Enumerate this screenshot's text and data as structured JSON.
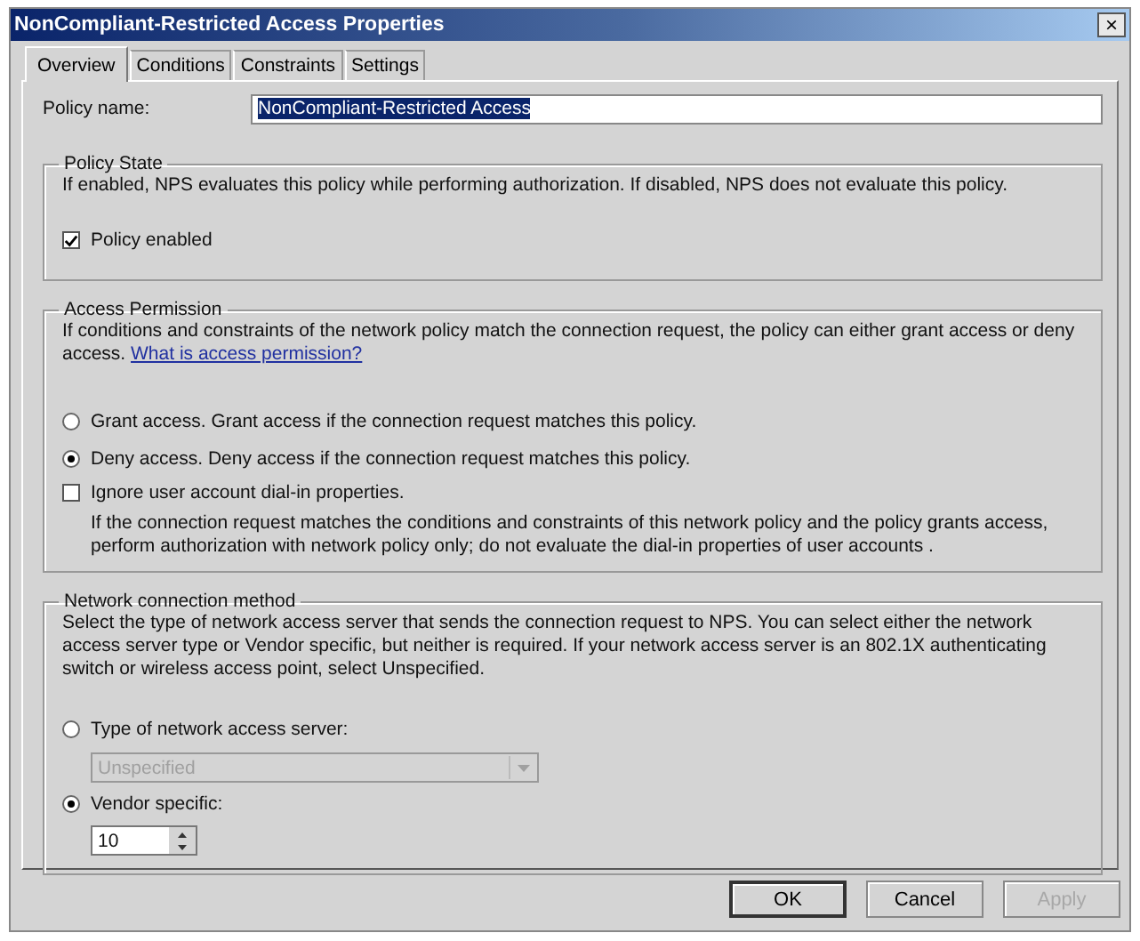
{
  "window": {
    "title": "NonCompliant-Restricted Access Properties",
    "close": "×"
  },
  "tabs": [
    {
      "label": "Overview",
      "selected": true
    },
    {
      "label": "Conditions",
      "selected": false
    },
    {
      "label": "Constraints",
      "selected": false
    },
    {
      "label": "Settings",
      "selected": false
    }
  ],
  "policy_name": {
    "label": "Policy name:",
    "value": "NonCompliant-Restricted Access"
  },
  "policy_state": {
    "title": "Policy State",
    "description": "If enabled, NPS evaluates this policy while performing authorization. If disabled, NPS does not evaluate this policy.",
    "checkbox": {
      "label": "Policy enabled",
      "checked": true
    }
  },
  "access_permission": {
    "title": "Access Permission",
    "description": "If conditions and constraints of the network policy match the connection request, the policy can either grant access or deny access.",
    "link": "What is access permission?",
    "options": [
      {
        "label": "Grant access. Grant access if the connection request matches this policy.",
        "selected": false
      },
      {
        "label": "Deny access. Deny access if the connection request matches this policy.",
        "selected": true
      }
    ],
    "checkbox": {
      "label": "Ignore user account dial-in properties.",
      "checked": false
    },
    "note": "If the connection request matches the conditions and constraints of this network policy and the policy grants access, perform authorization with network policy only; do not evaluate the dial-in properties of user accounts ."
  },
  "network_connection_method": {
    "title": "Network connection method",
    "description": "Select the type of network access server that sends the connection request to NPS. You can select either the network access server type or Vendor specific, but neither is required.  If your network access server is an 802.1X authenticating switch or wireless access point, select Unspecified.",
    "server_type": {
      "label": "Type of network access server:",
      "selected": false,
      "dropdown": {
        "value": "Unspecified",
        "disabled": true
      }
    },
    "vendor_specific": {
      "label": "Vendor specific:",
      "selected": true,
      "spinner": {
        "value": "10"
      }
    }
  },
  "buttons": [
    {
      "label": "OK",
      "default": true,
      "disabled": false
    },
    {
      "label": "Cancel",
      "default": false,
      "disabled": false
    },
    {
      "label": "Apply",
      "default": false,
      "disabled": true
    }
  ]
}
